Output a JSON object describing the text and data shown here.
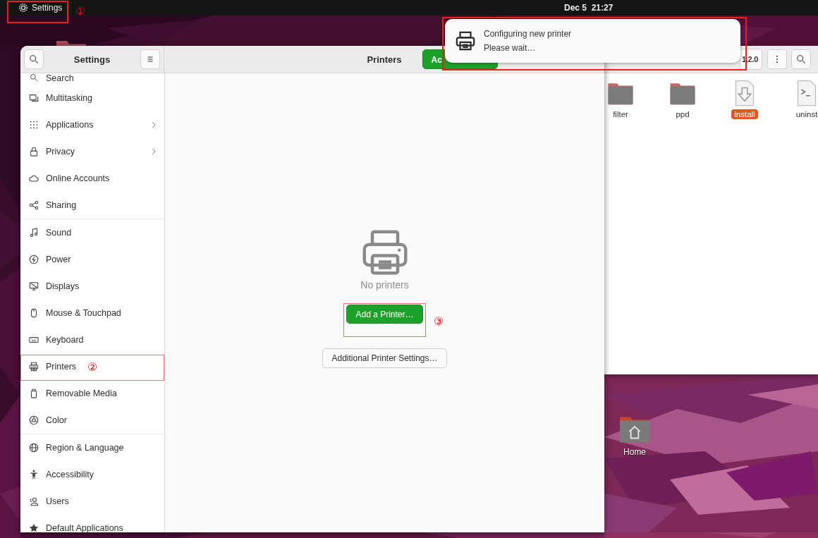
{
  "top_bar": {
    "app_menu": "Settings",
    "clock": "Dec 5  21:27"
  },
  "settings_window": {
    "title": "Settings",
    "page_title": "Printers",
    "header_button": "Ac",
    "sidebar": {
      "groups": [
        [
          {
            "label": "Search",
            "selected": false,
            "has_submenu": false
          },
          {
            "label": "Multitasking",
            "selected": false,
            "has_submenu": false
          },
          {
            "label": "Applications",
            "selected": false,
            "has_submenu": true
          },
          {
            "label": "Privacy",
            "selected": false,
            "has_submenu": true
          },
          {
            "label": "Online Accounts",
            "selected": false,
            "has_submenu": false
          },
          {
            "label": "Sharing",
            "selected": false,
            "has_submenu": false
          }
        ],
        [
          {
            "label": "Sound",
            "selected": false,
            "has_submenu": false
          },
          {
            "label": "Power",
            "selected": false,
            "has_submenu": false
          },
          {
            "label": "Displays",
            "selected": false,
            "has_submenu": false
          },
          {
            "label": "Mouse & Touchpad",
            "selected": false,
            "has_submenu": false
          },
          {
            "label": "Keyboard",
            "selected": false,
            "has_submenu": false
          },
          {
            "label": "Printers",
            "selected": false,
            "has_submenu": false
          },
          {
            "label": "Removable Media",
            "selected": false,
            "has_submenu": false
          },
          {
            "label": "Color",
            "selected": false,
            "has_submenu": false
          }
        ],
        [
          {
            "label": "Region & Language",
            "selected": false,
            "has_submenu": false
          },
          {
            "label": "Accessibility",
            "selected": false,
            "has_submenu": false
          },
          {
            "label": "Users",
            "selected": false,
            "has_submenu": false
          },
          {
            "label": "Default Applications",
            "selected": false,
            "has_submenu": false
          }
        ]
      ]
    },
    "empty_state": {
      "text": "No printers",
      "add_button": "Add a Printer…",
      "settings_button": "Additional Printer Settings…"
    }
  },
  "files_window": {
    "path_segment": "1.2.0",
    "items": [
      {
        "name": "filter",
        "kind": "folder",
        "selected": false
      },
      {
        "name": "ppd",
        "kind": "folder",
        "selected": false
      },
      {
        "name": "install",
        "kind": "installer",
        "selected": true
      },
      {
        "name": "uninst",
        "kind": "script",
        "selected": false
      }
    ]
  },
  "notification": {
    "title": "Configuring new printer",
    "body": "Please wait…"
  },
  "desktop_icons": [
    {
      "name": "Home",
      "kind": "home-folder"
    }
  ],
  "callouts": [
    "①",
    "②",
    "③"
  ]
}
